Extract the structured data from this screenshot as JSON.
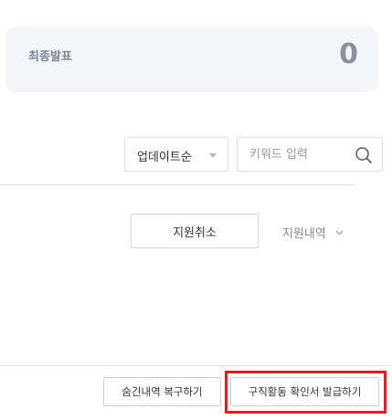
{
  "summary": {
    "label": "최종발표",
    "value": "0"
  },
  "filters": {
    "sort_selected": "업데이트순",
    "search_placeholder": "키워드 입력",
    "search_value": ""
  },
  "application": {
    "cancel_label": "지원취소",
    "details_label": "지원내역"
  },
  "actions": {
    "restore_label": "숨긴내역 복구하기",
    "issue_label": "구직활동 확인서 발급하기",
    "highlight_color": "#d42323"
  },
  "icons": {
    "search": "search-icon",
    "sort_dropdown": "caret-down-icon",
    "details_toggle": "chevron-down-icon"
  }
}
